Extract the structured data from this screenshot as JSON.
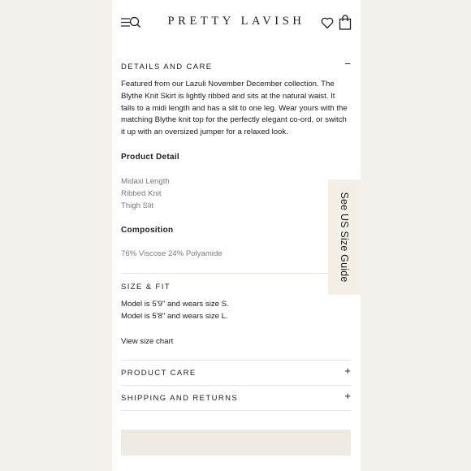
{
  "header": {
    "brand": "PRETTY LAVISH",
    "menu_icon": "menu-search-icon",
    "wishlist_icon": "heart-icon",
    "bag_icon": "shopping-bag-icon"
  },
  "details": {
    "title": "DETAILS AND CARE",
    "toggle": "−",
    "description": "Featured from our Lazuli November December collection. The Blythe Knit Skirt is lightly ribbed and sits at the natural waist. It falls to a midi length and has a slit to one leg. Wear yours with the matching Blythe knit top for the perfectly elegant co-ord, or switch it up with an oversized jumper for a relaxed look.",
    "product_detail_heading": "Product Detail",
    "product_detail_items": [
      "Midaxi Length",
      "Ribbed Knit",
      "Thigh Slit"
    ],
    "composition_heading": "Composition",
    "composition_value": "76% Viscose 24% Polyamide"
  },
  "size_fit": {
    "title": "SIZE & FIT",
    "model_lines": [
      "Model is 5'9\" and wears size S.",
      "Model is 5'8\" and wears size L."
    ],
    "size_chart_link": "View size chart"
  },
  "product_care": {
    "title": "PRODUCT CARE",
    "toggle": "+"
  },
  "shipping": {
    "title": "SHIPPING AND RETURNS",
    "toggle": "+"
  },
  "size_guide_tab": {
    "label": "See US Size Guide"
  },
  "colors": {
    "accent_tab": "#f4efe7",
    "cta": "#efeae3",
    "muted_text": "#7a7a7a"
  }
}
